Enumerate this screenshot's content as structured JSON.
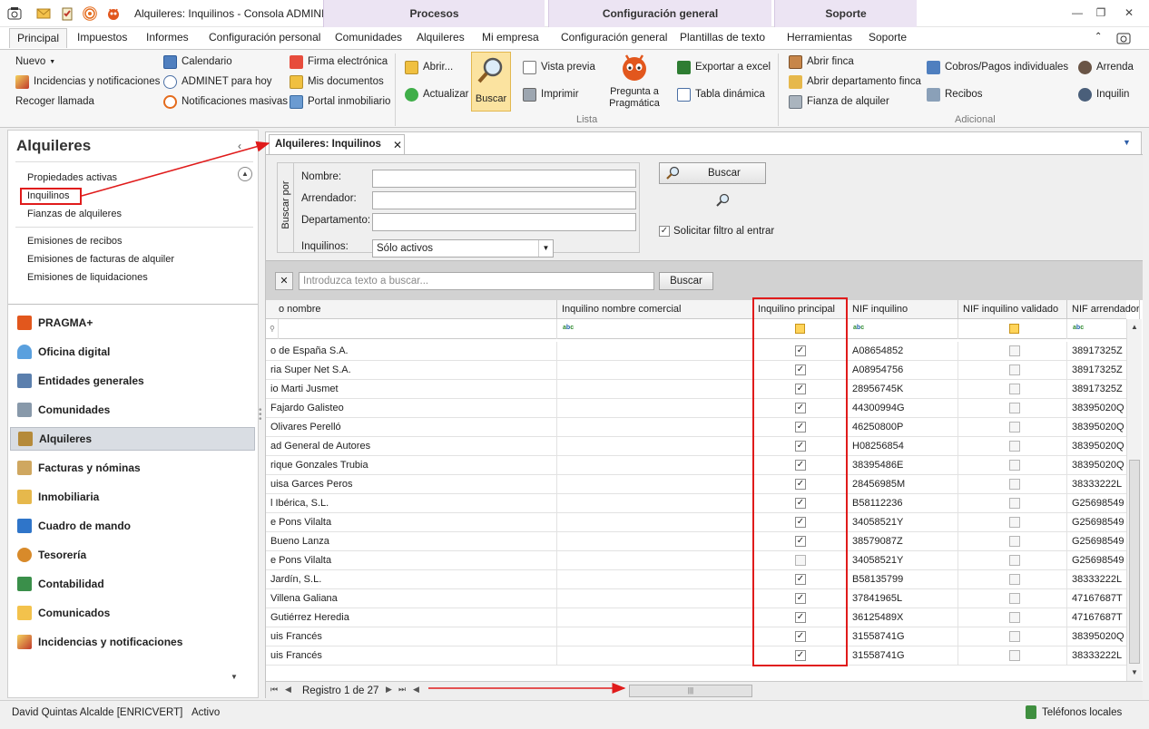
{
  "window": {
    "title": "Alquileres: Inquilinos - Consola ADMINET",
    "context_headers": [
      "Procesos",
      "Configuración general",
      "Soporte"
    ]
  },
  "ribbon_tabs": [
    "Principal",
    "Impuestos",
    "Informes",
    "Configuración personal",
    "Comunidades",
    "Alquileres",
    "Mi empresa",
    "Configuración general",
    "Plantillas de texto",
    "Herramientas",
    "Soporte"
  ],
  "ribbon": {
    "nuevo": "Nuevo",
    "incidencias": "Incidencias y notificaciones",
    "recoger": "Recoger llamada",
    "calendario": "Calendario",
    "adminet_hoy": "ADMINET para hoy",
    "notificaciones": "Notificaciones masivas",
    "firma": "Firma electrónica",
    "mis_documentos": "Mis documentos",
    "portal": "Portal inmobiliario",
    "abrir": "Abrir...",
    "actualizar": "Actualizar",
    "buscar": "Buscar",
    "vista_previa": "Vista previa",
    "imprimir": "Imprimir",
    "pregunta_a": "Pregunta a",
    "pragmatica": "Pragmática",
    "exportar": "Exportar a excel",
    "tabla_dinamica": "Tabla dinámica",
    "lista_label": "Lista",
    "abrir_finca": "Abrir finca",
    "abrir_departamento": "Abrir departamento finca",
    "fianza": "Fianza de alquiler",
    "cobros_pagos": "Cobros/Pagos individuales",
    "recibos": "Recibos",
    "arrenda": "Arrenda",
    "inquilin": "Inquilin",
    "adicional_label": "Adicional"
  },
  "nav": {
    "title": "Alquileres",
    "links": [
      "Propiedades activas",
      "Inquilinos",
      "Fianzas de alquileres",
      "Emisiones de recibos",
      "Emisiones de facturas de alquiler",
      "Emisiones de liquidaciones"
    ],
    "modules": [
      "PRAGMA+",
      "Oficina digital",
      "Entidades generales",
      "Comunidades",
      "Alquileres",
      "Facturas y nóminas",
      "Inmobiliaria",
      "Cuadro de mando",
      "Tesorería",
      "Contabilidad",
      "Comunicados",
      "Incidencias y notificaciones"
    ],
    "active_module": "Alquileres"
  },
  "doc_tab": "Alquileres: Inquilinos",
  "search": {
    "group_label": "Buscar por",
    "nombre_label": "Nombre:",
    "arrendador_label": "Arrendador:",
    "departamento_label": "Departamento:",
    "inquilinos_label": "Inquilinos:",
    "inquilinos_value": "Sólo activos",
    "buscar_btn": "Buscar",
    "solicitar_filtro": "Solicitar filtro al entrar",
    "solicitar_checked": true
  },
  "findbar": {
    "placeholder": "Introduzca texto a buscar...",
    "button": "Buscar"
  },
  "grid": {
    "columns": [
      "o nombre",
      "Inquilino nombre comercial",
      "Inquilino principal",
      "NIF inquilino",
      "NIF inquilino validado",
      "NIF arrendador"
    ],
    "rows": [
      {
        "nombre": "o de España S.A.",
        "comercial": "",
        "principal": true,
        "nif": "A08654852",
        "validado": false,
        "nif_arr": "38917325Z"
      },
      {
        "nombre": "ria Super Net S.A.",
        "comercial": "",
        "principal": true,
        "nif": "A08954756",
        "validado": false,
        "nif_arr": "38917325Z"
      },
      {
        "nombre": "io Marti Jusmet",
        "comercial": "",
        "principal": true,
        "nif": "28956745K",
        "validado": false,
        "nif_arr": "38917325Z"
      },
      {
        "nombre": "Fajardo Galisteo",
        "comercial": "",
        "principal": true,
        "nif": "44300994G",
        "validado": false,
        "nif_arr": "38395020Q"
      },
      {
        "nombre": " Olivares Perelló",
        "comercial": "",
        "principal": true,
        "nif": "46250800P",
        "validado": false,
        "nif_arr": "38395020Q"
      },
      {
        "nombre": "ad General de Autores",
        "comercial": "",
        "principal": true,
        "nif": "H08256854",
        "validado": false,
        "nif_arr": "38395020Q"
      },
      {
        "nombre": "rique Gonzales Trubia",
        "comercial": "",
        "principal": true,
        "nif": "38395486E",
        "validado": false,
        "nif_arr": "38395020Q"
      },
      {
        "nombre": "uisa Garces Peros",
        "comercial": "",
        "principal": true,
        "nif": "28456985M",
        "validado": false,
        "nif_arr": "38333222L"
      },
      {
        "nombre": "l Ibérica, S.L.",
        "comercial": "",
        "principal": true,
        "nif": "B58112236",
        "validado": false,
        "nif_arr": "G25698549"
      },
      {
        "nombre": "e Pons Vilalta",
        "comercial": "",
        "principal": true,
        "nif": "34058521Y",
        "validado": false,
        "nif_arr": "G25698549"
      },
      {
        "nombre": "Bueno Lanza",
        "comercial": "",
        "principal": true,
        "nif": "38579087Z",
        "validado": false,
        "nif_arr": "G25698549"
      },
      {
        "nombre": "e Pons Vilalta",
        "comercial": "",
        "principal": false,
        "nif": "34058521Y",
        "validado": false,
        "nif_arr": "G25698549"
      },
      {
        "nombre": "Jardín, S.L.",
        "comercial": "",
        "principal": true,
        "nif": "B58135799",
        "validado": false,
        "nif_arr": "38333222L"
      },
      {
        "nombre": "Villena Galiana",
        "comercial": "",
        "principal": true,
        "nif": "37841965L",
        "validado": false,
        "nif_arr": "47167687T"
      },
      {
        "nombre": " Gutiérrez Heredia",
        "comercial": "",
        "principal": true,
        "nif": "36125489X",
        "validado": false,
        "nif_arr": "47167687T"
      },
      {
        "nombre": "uis Francés",
        "comercial": "",
        "principal": true,
        "nif": "31558741G",
        "validado": false,
        "nif_arr": "38395020Q"
      },
      {
        "nombre": "uis Francés",
        "comercial": "",
        "principal": true,
        "nif": "31558741G",
        "validado": false,
        "nif_arr": "38333222L"
      }
    ]
  },
  "pager": {
    "text": "Registro 1 de 27"
  },
  "status": {
    "user": "David Quintas Alcalde [ENRICVERT]",
    "state": "Activo",
    "phones": "Teléfonos locales"
  },
  "colors": {
    "annotation_red": "#e01b1b",
    "active_button": "#fbe3a0",
    "context_header": "#ece4f3"
  }
}
